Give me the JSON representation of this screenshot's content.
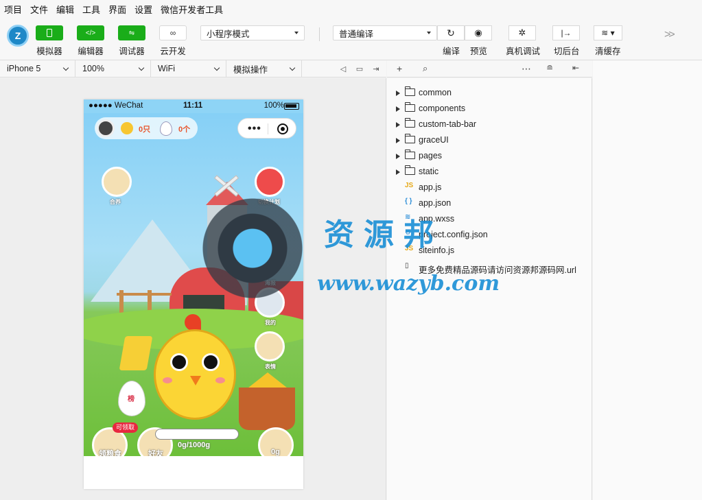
{
  "menu": [
    "项目",
    "文件",
    "编辑",
    "工具",
    "界面",
    "设置",
    "微信开发者工具"
  ],
  "toolbar": {
    "simulator": "模拟器",
    "editor": "编辑器",
    "debugger": "调试器",
    "cloud": "云开发",
    "mode": "小程序模式",
    "compile_mode": "普通编译",
    "compile": "编译",
    "preview": "预览",
    "remote_debug": "真机调试",
    "background": "切后台",
    "clear_cache": "清缓存"
  },
  "simbar": {
    "device": "iPhone 5",
    "zoom": "100%",
    "network": "WiFi",
    "operation": "模拟操作"
  },
  "phone": {
    "carrier": "●●●●● WeChat",
    "time": "11:11",
    "battery": "100%",
    "chick_count": "0只",
    "egg_count": "0个",
    "btn_hatch": "合养",
    "btn_switch": "切换计划",
    "btn_poster": "海报",
    "btn_mine": "我的",
    "btn_chat": "表情",
    "egg_rank": "榜",
    "badge": "可领取",
    "progress_text": "0g/1000g",
    "progress_fraction": 0,
    "bottom_feed": "领粮食",
    "bottom_friends": "好友",
    "bottom_grain": "0g"
  },
  "explorer": {
    "folders": [
      "common",
      "components",
      "custom-tab-bar",
      "graceUI",
      "pages",
      "static"
    ],
    "files": [
      {
        "icon": "JS",
        "name": "app.js",
        "color": "#e6a817"
      },
      {
        "icon": "{ }",
        "name": "app.json",
        "color": "#2f8fd8"
      },
      {
        "icon": "≋",
        "name": "app.wxss",
        "color": "#2f8fd8"
      },
      {
        "icon": "⚙",
        "name": "project.config.json",
        "color": "#2f8fd8"
      },
      {
        "icon": "JS",
        "name": "siteinfo.js",
        "color": "#e6a817"
      },
      {
        "icon": "▯",
        "name": "更多免费精品源码请访问资源邦源码网.url",
        "color": "#333"
      }
    ]
  },
  "watermark": {
    "title": "资源邦",
    "url": "www.wazyb.com"
  }
}
